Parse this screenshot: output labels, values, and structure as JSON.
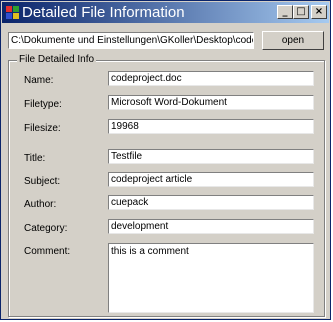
{
  "window": {
    "title": "Detailed File Information",
    "controls": {
      "minimize": "_",
      "maximize": "□",
      "close": "×"
    }
  },
  "toolbar": {
    "path_value": "C:\\Dokumente und Einstellungen\\GKoller\\Desktop\\codeproject.doc",
    "open_label": "open"
  },
  "group": {
    "title": "File Detailed Info"
  },
  "fields": {
    "name": {
      "label": "Name:",
      "value": "codeproject.doc"
    },
    "filetype": {
      "label": "Filetype:",
      "value": "Microsoft Word-Dokument"
    },
    "filesize": {
      "label": "Filesize:",
      "value": "19968"
    },
    "title": {
      "label": "Title:",
      "value": "Testfile"
    },
    "subject": {
      "label": "Subject:",
      "value": "codeproject article"
    },
    "author": {
      "label": "Author:",
      "value": "cuepack"
    },
    "category": {
      "label": "Category:",
      "value": "development"
    },
    "comment": {
      "label": "Comment:",
      "value": "this is a comment"
    }
  }
}
